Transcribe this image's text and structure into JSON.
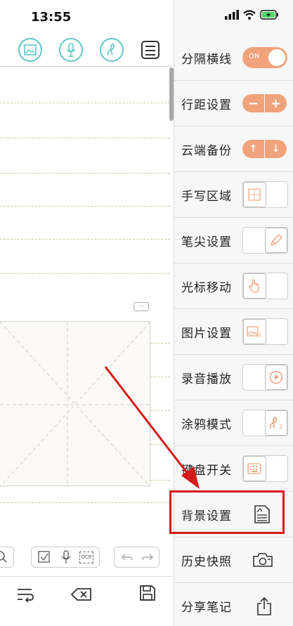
{
  "status": {
    "time": "13:55"
  },
  "colors": {
    "accent": "#f0a37b",
    "teal": "#5fc7c4",
    "highlight": "#d61a1a",
    "battery": "#4cd964"
  },
  "toolbar": {
    "icons": [
      "image-icon",
      "microphone-icon",
      "handwriting-icon",
      "menu-icon"
    ]
  },
  "hw_box": {
    "dots": "···"
  },
  "sub_toolbar": {
    "ocr": "OCR"
  },
  "settings": {
    "rows": [
      {
        "label": "分隔横线",
        "control": "toggle",
        "value": "ON"
      },
      {
        "label": "行距设置",
        "control": "minus-plus",
        "minus": "−",
        "plus": "+"
      },
      {
        "label": "云端备份",
        "control": "up-down",
        "up": "↑",
        "down": "↓"
      },
      {
        "label": "手写区域",
        "control": "segmented",
        "selected": "left"
      },
      {
        "label": "笔尖设置",
        "control": "segmented",
        "selected": "right"
      },
      {
        "label": "光标移动",
        "control": "segmented",
        "selected": "left"
      },
      {
        "label": "图片设置",
        "control": "segmented",
        "selected": "left"
      },
      {
        "label": "录音播放",
        "control": "segmented",
        "selected": "right"
      },
      {
        "label": "涂鸦模式",
        "control": "segmented",
        "selected": "right"
      },
      {
        "label": "键盘开关",
        "control": "segmented",
        "selected": "left"
      },
      {
        "label": "背景设置",
        "control": "icon"
      },
      {
        "label": "历史快照",
        "control": "icon"
      },
      {
        "label": "分享笔记",
        "control": "icon"
      }
    ]
  }
}
